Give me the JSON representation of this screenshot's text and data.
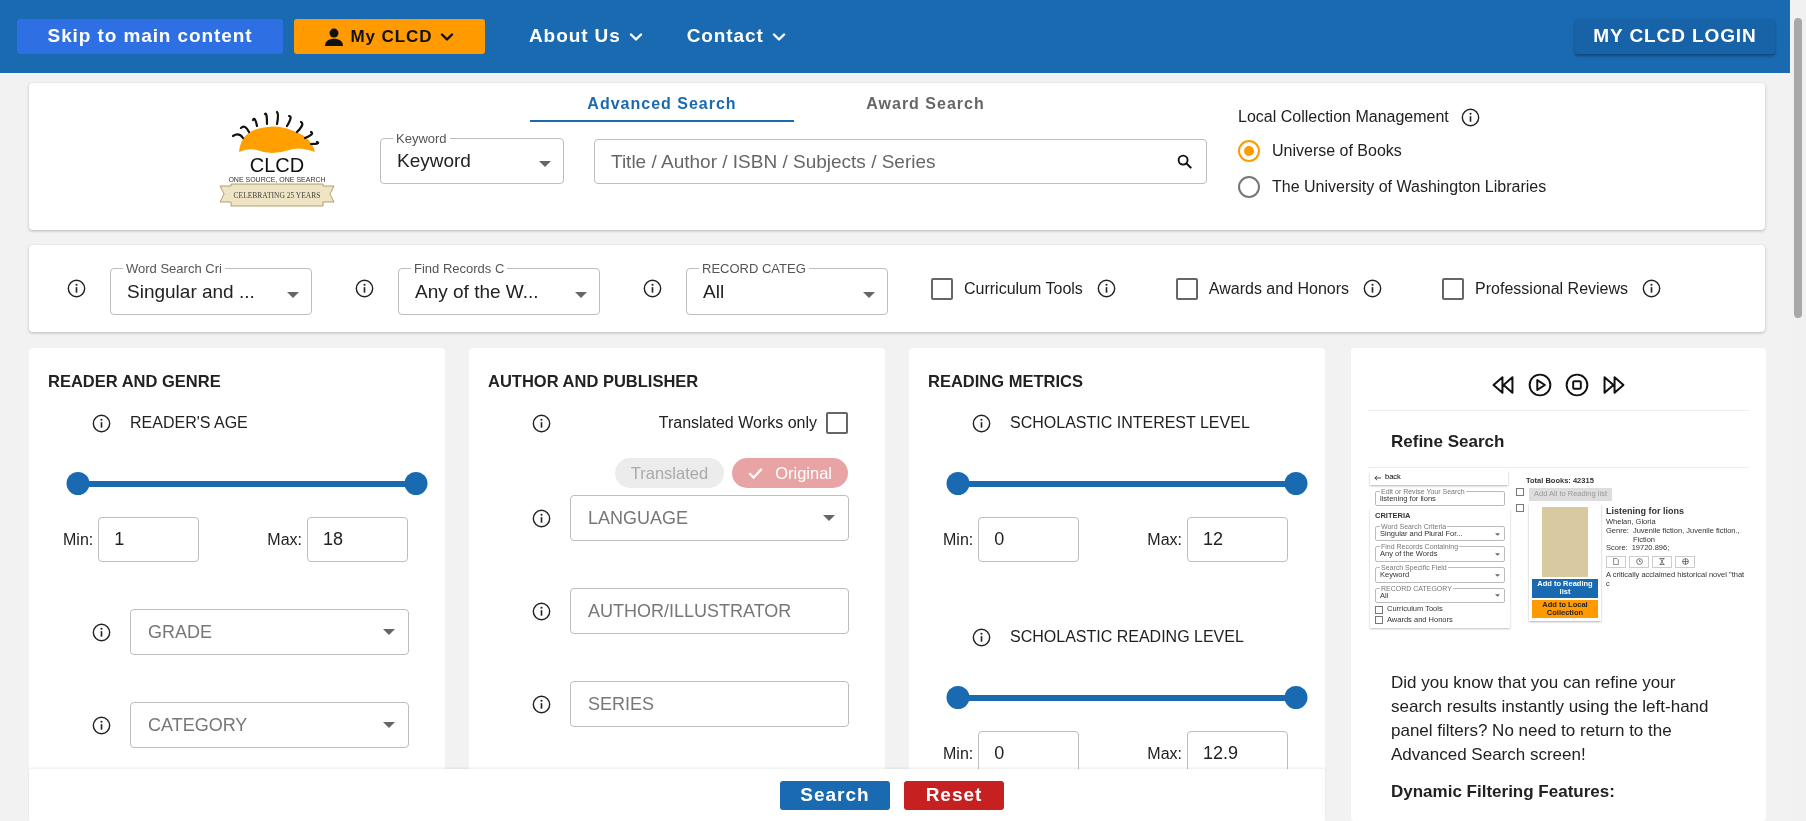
{
  "top_nav": {
    "skip_link": "Skip to main content",
    "my_clcd": "My CLCD",
    "menus": [
      "About Us",
      "Contact"
    ],
    "login": "MY CLCD LOGIN"
  },
  "header": {
    "logo": {
      "name": "CLCD",
      "tagline": "ONE SOURCE, ONE SEARCH",
      "banner": "CELEBRATING 25 YEARS"
    },
    "tabs": [
      {
        "label": "Advanced Search",
        "selected": true
      },
      {
        "label": "Award Search",
        "selected": false
      }
    ],
    "field_select": {
      "label": "Keyword",
      "value": "Keyword"
    },
    "search": {
      "placeholder": "Title / Author / ISBN / Subjects / Series"
    },
    "collection": {
      "title": "Local Collection Management",
      "options": [
        {
          "label": "Universe of Books",
          "selected": true
        },
        {
          "label": "The University of Washington Libraries",
          "selected": false
        }
      ]
    }
  },
  "filters": {
    "selects": [
      {
        "label": "Word Search Cri",
        "value": "Singular and ..."
      },
      {
        "label": "Find Records C",
        "value": "Any of the W..."
      },
      {
        "label": "RECORD CATEG",
        "value": "All"
      }
    ],
    "checkboxes": [
      {
        "label": "Curriculum Tools",
        "checked": false
      },
      {
        "label": "Awards and Honors",
        "checked": false
      },
      {
        "label": "Professional Reviews",
        "checked": false
      }
    ]
  },
  "panels": [
    {
      "title": "READER AND GENRE",
      "rows": [
        {
          "kind": "range",
          "label": "READER'S AGE",
          "thumbs": [
            {
              "level": 0
            },
            {
              "level": 1
            }
          ],
          "min_label": "Min:",
          "min_value": "1",
          "max_label": "Max:",
          "max_value": "18"
        },
        {
          "kind": "select",
          "placeholder": "GRADE"
        },
        {
          "kind": "select",
          "placeholder": "CATEGORY"
        }
      ]
    },
    {
      "title": "AUTHOR AND PUBLISHER",
      "rows": [
        {
          "kind": "check",
          "label": "Translated Works only",
          "checked": false
        },
        {
          "kind": "chips",
          "chips": [
            {
              "label": "Translated",
              "selected": false
            },
            {
              "label": "Original",
              "selected": true
            }
          ]
        },
        {
          "kind": "select",
          "placeholder": "LANGUAGE"
        },
        {
          "kind": "text",
          "placeholder": "AUTHOR/ILLUSTRATOR"
        },
        {
          "kind": "text",
          "placeholder": "SERIES"
        }
      ]
    },
    {
      "title": "READING METRICS",
      "rows": [
        {
          "kind": "range",
          "label": "SCHOLASTIC INTEREST LEVEL",
          "thumbs": [
            {
              "level": 0
            },
            {
              "level": 1
            }
          ],
          "min_label": "Min:",
          "min_value": "0",
          "max_label": "Max:",
          "max_value": "12"
        },
        {
          "kind": "range",
          "label": "SCHOLASTIC READING LEVEL",
          "thumbs": [
            {
              "level": 0
            },
            {
              "level": 1
            }
          ],
          "min_label": "Min:",
          "min_value": "0",
          "max_label": "Max:",
          "max_value": "12.9"
        }
      ]
    }
  ],
  "refine_panel": {
    "title": "Refine Search",
    "preview": {
      "back": "back",
      "search_label": "Edit or Revise Your Search",
      "search_value": "listening for lions",
      "criteria_title": "CRITERIA",
      "selects": [
        {
          "label": "Word Search Criteria",
          "value": "Singular and Plural For..."
        },
        {
          "label": "Find Records Containing",
          "value": "Any of the Words"
        },
        {
          "label": "Search Specific Field",
          "value": "Keyword"
        },
        {
          "label": "RECORD CATEGORY",
          "value": "All"
        }
      ],
      "checkboxes": [
        {
          "label": "Curriculum Tools",
          "checked": false
        },
        {
          "label": "Awards and Honors",
          "checked": false
        }
      ],
      "total": "Total Books: 42315",
      "add_all_checked": false,
      "add_all": "Add All to Reading list",
      "book": {
        "checked": false,
        "title": "Listening for lions",
        "author": "Whelan, Gloria",
        "fields": [
          {
            "label": "Genre:",
            "value": "Juvenile fiction, Juvenile fiction., Fiction"
          },
          {
            "label": "Score:",
            "value": "19720.896;"
          }
        ],
        "description": "A critically acclaimed historical novel \"that c",
        "add_reading": "Add to Reading list",
        "add_local": "Add to Local Collection"
      }
    },
    "text": "Did you know that you can refine your search results instantly using the left-hand panel filters? No need to return to the Advanced Search screen!",
    "subheading": "Dynamic Filtering Features:"
  },
  "footer": {
    "buttons": [
      {
        "label": "Search",
        "kind": "submit"
      },
      {
        "label": "Reset",
        "kind": "reset"
      }
    ]
  }
}
